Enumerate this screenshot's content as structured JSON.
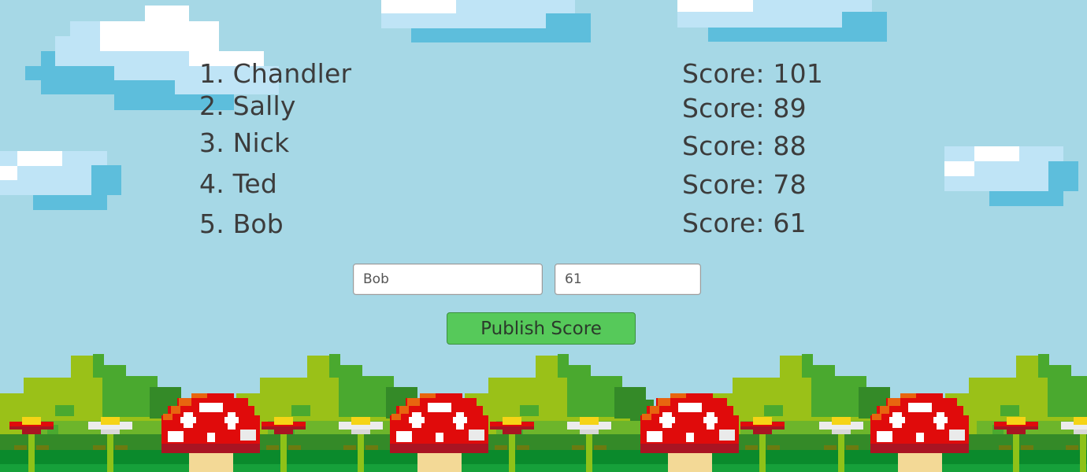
{
  "leaderboard": {
    "entries": [
      {
        "name": "1. Chandler",
        "score": "Score: 101"
      },
      {
        "name": "2. Sally",
        "score": "Score: 89"
      },
      {
        "name": "3. Nick",
        "score": "Score: 88"
      },
      {
        "name": "4. Ted",
        "score": "Score: 78"
      },
      {
        "name": "5. Bob",
        "score": "Score: 61"
      }
    ]
  },
  "form": {
    "name_value": "Bob",
    "score_value": "61",
    "publish_label": "Publish Score"
  },
  "theme": {
    "sky": "#a6d8e6",
    "button": "#56c95a",
    "text": "#3c3c3c"
  }
}
